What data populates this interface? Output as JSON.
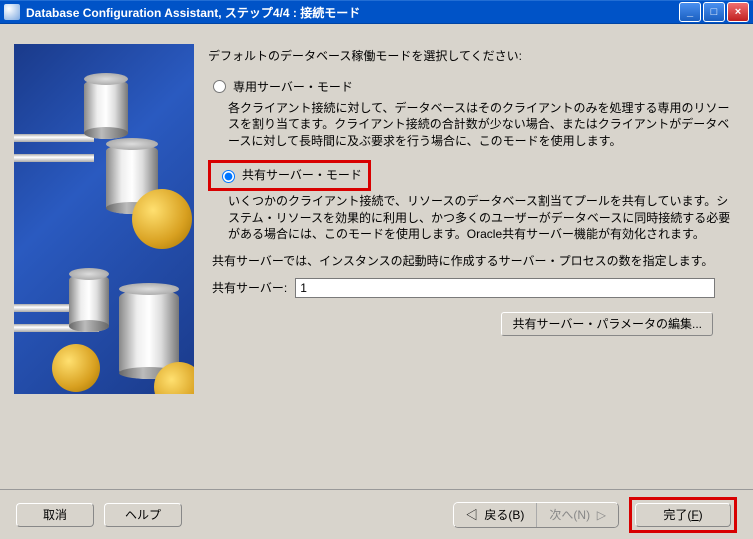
{
  "titlebar": {
    "title": "Database Configuration Assistant, ステップ4/4 : 接続モード"
  },
  "main": {
    "prompt": "デフォルトのデータベース稼働モードを選択してください:",
    "dedicated": {
      "label": "専用サーバー・モード",
      "desc": "各クライアント接続に対して、データベースはそのクライアントのみを処理する専用のリソースを割り当てます。クライアント接続の合計数が少ない場合、またはクライアントがデータベースに対して長時間に及ぶ要求を行う場合に、このモードを使用します。"
    },
    "shared": {
      "label": "共有サーバー・モード",
      "desc": "いくつかのクライアント接続で、リソースのデータベース割当てプールを共有しています。システム・リソースを効果的に利用し、かつ多くのユーザーがデータベースに同時接続する必要がある場合には、このモードを使用します。Oracle共有サーバー機能が有効化されます。",
      "note": "共有サーバーでは、インスタンスの起動時に作成するサーバー・プロセスの数を指定します。",
      "field_label": "共有サーバー:",
      "field_value": "1",
      "edit_button": "共有サーバー・パラメータの編集..."
    }
  },
  "footer": {
    "cancel": "取消",
    "help": "ヘルプ",
    "back": "戻る(B)",
    "next": "次へ(N)",
    "finish": "完了(F)"
  }
}
